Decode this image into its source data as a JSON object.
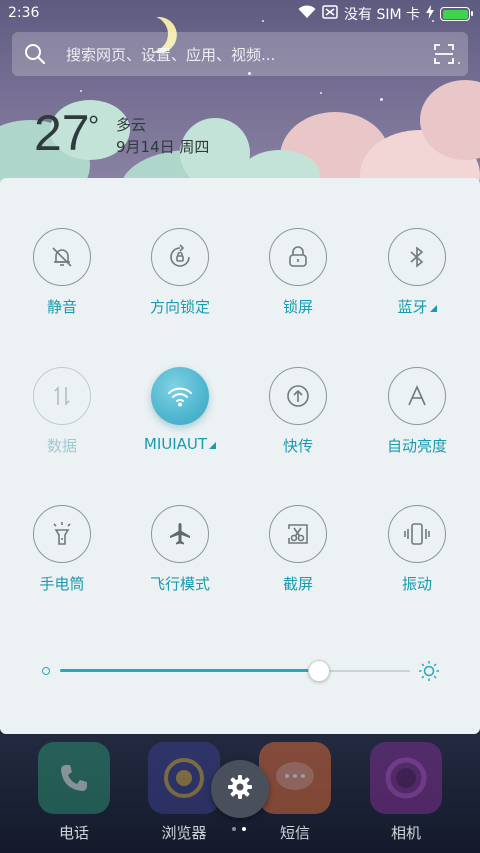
{
  "status_bar": {
    "time": "2:36",
    "sim_text": "没有 SIM 卡"
  },
  "search": {
    "placeholder": "搜索网页、设置、应用、视频..."
  },
  "weather": {
    "temperature": "27",
    "degree_symbol": "°",
    "condition": "多云",
    "date": "9月14日 周四"
  },
  "toggles": [
    {
      "label": "静音",
      "icon": "silent-bell-icon",
      "state": "off"
    },
    {
      "label": "方向锁定",
      "icon": "rotation-lock-icon",
      "state": "off"
    },
    {
      "label": "锁屏",
      "icon": "lock-icon",
      "state": "off"
    },
    {
      "label": "蓝牙",
      "icon": "bluetooth-icon",
      "state": "off"
    },
    {
      "label": "数据",
      "icon": "mobile-data-icon",
      "state": "disabled"
    },
    {
      "label": "MIUIAUT",
      "icon": "wifi-icon",
      "state": "on"
    },
    {
      "label": "快传",
      "icon": "quick-transfer-icon",
      "state": "off"
    },
    {
      "label": "自动亮度",
      "icon": "auto-brightness-icon",
      "state": "off"
    },
    {
      "label": "手电筒",
      "icon": "flashlight-icon",
      "state": "off"
    },
    {
      "label": "飞行模式",
      "icon": "airplane-icon",
      "state": "off"
    },
    {
      "label": "截屏",
      "icon": "screenshot-icon",
      "state": "off"
    },
    {
      "label": "振动",
      "icon": "vibrate-icon",
      "state": "off"
    }
  ],
  "brightness": {
    "level": 0.74
  },
  "dock_apps": [
    {
      "label": "电话",
      "icon": "phone-icon"
    },
    {
      "label": "浏览器",
      "icon": "browser-icon"
    },
    {
      "label": "短信",
      "icon": "messages-icon"
    },
    {
      "label": "相机",
      "icon": "camera-icon"
    }
  ],
  "colors": {
    "accent": "#1a9aaf",
    "active_toggle": "#4fb6cf",
    "panel_bg": "#ecf2f3"
  }
}
